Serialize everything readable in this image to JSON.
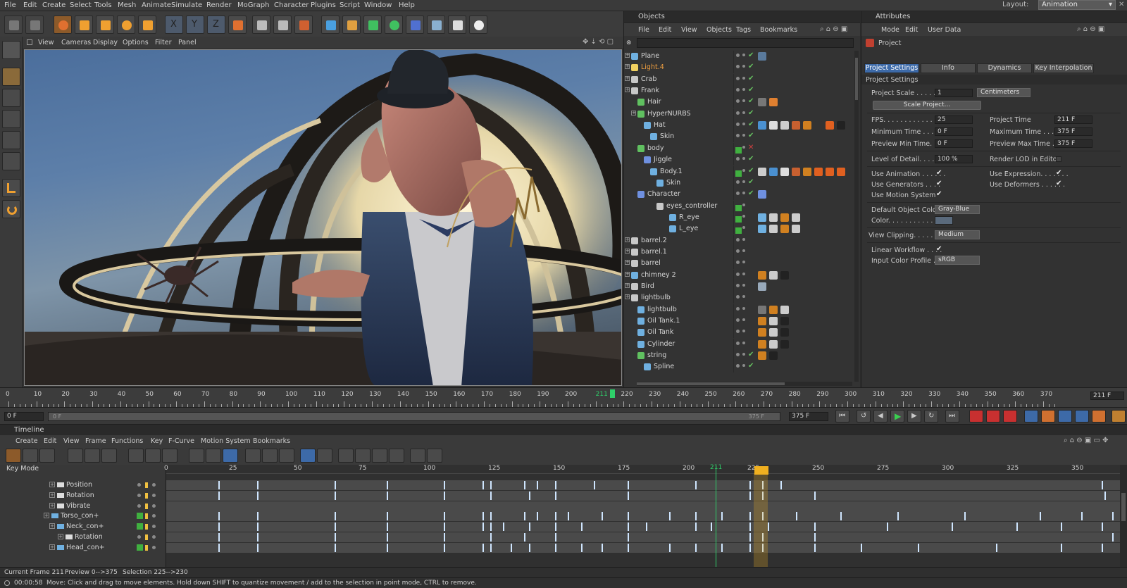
{
  "menubar": {
    "items": [
      "File",
      "Edit",
      "Create",
      "Select",
      "Tools",
      "Mesh",
      "Animate",
      "Simulate",
      "Render",
      "MoGraph",
      "Character",
      "Plugins",
      "Script",
      "Window",
      "Help"
    ],
    "layout_label": "Layout:",
    "layout_value": "Animation"
  },
  "viewport": {
    "menu": [
      "View",
      "Cameras",
      "Display",
      "Options",
      "Filter",
      "Panel"
    ]
  },
  "objects": {
    "title": "Objects",
    "menu": [
      "File",
      "Edit",
      "View",
      "Objects",
      "Tags",
      "Bookmarks"
    ],
    "rows": [
      {
        "name": "Plane",
        "indent": 0,
        "color": "#6fb0e0",
        "highlight": false
      },
      {
        "name": "Light.4",
        "indent": 0,
        "color": "#f0d060",
        "highlight": true
      },
      {
        "name": "Crab",
        "indent": 0,
        "color": "#c8c8c8",
        "highlight": false
      },
      {
        "name": "Frank",
        "indent": 0,
        "color": "#c8c8c8",
        "highlight": false
      },
      {
        "name": "Hair",
        "indent": 1,
        "color": "#60c060",
        "highlight": false
      },
      {
        "name": "HyperNURBS",
        "indent": 1,
        "color": "#60c060",
        "highlight": false
      },
      {
        "name": "Hat",
        "indent": 2,
        "color": "#6fb0e0",
        "highlight": false
      },
      {
        "name": "Skin",
        "indent": 3,
        "color": "#6fb0e0",
        "highlight": false
      },
      {
        "name": "body",
        "indent": 1,
        "color": "#60c060",
        "highlight": false
      },
      {
        "name": "Jiggle",
        "indent": 2,
        "color": "#6f90e0",
        "highlight": false
      },
      {
        "name": "Body.1",
        "indent": 3,
        "color": "#6fb0e0",
        "highlight": false
      },
      {
        "name": "Skin",
        "indent": 4,
        "color": "#6fb0e0",
        "highlight": false
      },
      {
        "name": "Character",
        "indent": 1,
        "color": "#6f90e0",
        "highlight": false
      },
      {
        "name": "eyes_controller",
        "indent": 4,
        "color": "#c8c8c8",
        "highlight": false
      },
      {
        "name": "R_eye",
        "indent": 6,
        "color": "#6fb0e0",
        "highlight": false
      },
      {
        "name": "L_eye",
        "indent": 6,
        "color": "#6fb0e0",
        "highlight": false
      },
      {
        "name": "barrel.2",
        "indent": 0,
        "color": "#c8c8c8",
        "highlight": false
      },
      {
        "name": "barrel.1",
        "indent": 0,
        "color": "#c8c8c8",
        "highlight": false
      },
      {
        "name": "barrel",
        "indent": 0,
        "color": "#c8c8c8",
        "highlight": false
      },
      {
        "name": "chimney 2",
        "indent": 0,
        "color": "#6fb0e0",
        "highlight": false
      },
      {
        "name": "Bird",
        "indent": 0,
        "color": "#c8c8c8",
        "highlight": false
      },
      {
        "name": "lightbulb",
        "indent": 0,
        "color": "#c8c8c8",
        "highlight": false
      },
      {
        "name": "lightbulb",
        "indent": 1,
        "color": "#6fb0e0",
        "highlight": false
      },
      {
        "name": "Oil Tank.1",
        "indent": 1,
        "color": "#6fb0e0",
        "highlight": false
      },
      {
        "name": "Oil Tank",
        "indent": 1,
        "color": "#6fb0e0",
        "highlight": false
      },
      {
        "name": "Cylinder",
        "indent": 1,
        "color": "#6fb0e0",
        "highlight": false
      },
      {
        "name": "string",
        "indent": 1,
        "color": "#60c060",
        "highlight": false
      },
      {
        "name": "Spline",
        "indent": 2,
        "color": "#6fb0e0",
        "highlight": false
      }
    ]
  },
  "attributes": {
    "title": "Attributes",
    "menu": [
      "Mode",
      "Edit",
      "User Data"
    ],
    "object": "Project",
    "tabs": [
      "Project Settings",
      "Info",
      "Dynamics",
      "Key Interpolation"
    ],
    "section": "Project Settings",
    "project_scale_label": "Project Scale . . . . . . . .",
    "project_scale_value": "1",
    "project_scale_unit": "Centimeters",
    "scale_button": "Scale Project...",
    "fps_label": "FPS. . . . . . . . . . . . . . . . .",
    "fps_value": "25",
    "project_time_label": "Project Time",
    "project_time_value": "211 F",
    "min_time_label": "Minimum Time . . . . . .",
    "min_time_value": "0 F",
    "max_time_label": "Maximum Time . . . . .",
    "max_time_value": "375 F",
    "prev_min_label": "Preview Min Time. . . . .",
    "prev_min_value": "0 F",
    "prev_max_label": "Preview Max Time . . .",
    "prev_max_value": "375 F",
    "lod_label": "Level of Detail. . . . . .",
    "lod_value": "100 %",
    "render_lod_label": "Render LOD in Editor",
    "use_animation": "Use Animation . . . . . .",
    "use_expression": "Use Expression. . . . . . .",
    "use_generators": "Use Generators . . . .",
    "use_deformers": "Use Deformers . . . . . .",
    "use_motion": "Use Motion System",
    "default_color_label": "Default Object Color",
    "default_color_value": "Gray-Blue",
    "color_label": "Color. . . . . . . . . . . . . .",
    "view_clipping_label": "View Clipping. . . . . .",
    "view_clipping_value": "Medium",
    "linear_workflow": "Linear Workflow . . . .",
    "input_profile_label": "Input Color Profile . .",
    "input_profile_value": "sRGB"
  },
  "ruler": {
    "ticks": [
      "0",
      "10",
      "20",
      "30",
      "40",
      "50",
      "60",
      "70",
      "80",
      "90",
      "100",
      "110",
      "120",
      "130",
      "140",
      "150",
      "160",
      "170",
      "180",
      "190",
      "200",
      "211",
      "220",
      "230",
      "240",
      "250",
      "260",
      "270",
      "280",
      "290",
      "300",
      "310",
      "320",
      "330",
      "340",
      "350",
      "360",
      "370"
    ],
    "current": "211",
    "end_field": "211 F"
  },
  "playback": {
    "start_field": "0 F",
    "range_start": "0 F",
    "range_end": "375 F",
    "end_field": "375 F"
  },
  "timeline": {
    "title": "Timeline",
    "menu": [
      "Create",
      "Edit",
      "View",
      "Frame",
      "Functions",
      "Key",
      "F-Curve",
      "Motion System",
      "Bookmarks"
    ],
    "key_mode": "Key Mode",
    "ticks": [
      "0",
      "25",
      "50",
      "75",
      "100",
      "125",
      "150",
      "175",
      "200",
      "225",
      "250",
      "275",
      "300",
      "325",
      "350"
    ],
    "current": "211",
    "tracks": [
      {
        "name": "Position",
        "indent": 1,
        "green": false
      },
      {
        "name": "Rotation",
        "indent": 1,
        "green": false
      },
      {
        "name": "Vibrate",
        "indent": 1,
        "green": false
      },
      {
        "name": "Torso_con+",
        "indent": 0,
        "green": true
      },
      {
        "name": "Neck_con+",
        "indent": 1,
        "green": true
      },
      {
        "name": "Rotation",
        "indent": 2,
        "green": false
      },
      {
        "name": "Head_con+",
        "indent": 1,
        "green": true
      }
    ]
  },
  "status": {
    "current_frame": "Current Frame  211",
    "preview": "Preview  0-->375",
    "selection": "Selection  225-->230",
    "time": "00:00:58",
    "message": "Move: Click and drag to move elements. Hold down SHIFT to quantize movement / add to the selection in point mode, CTRL to remove."
  },
  "colors": {
    "accent": "#3d6aa8",
    "playhead": "#2fd06a",
    "key": "#cfe6ff",
    "selection": "#f0b020"
  }
}
